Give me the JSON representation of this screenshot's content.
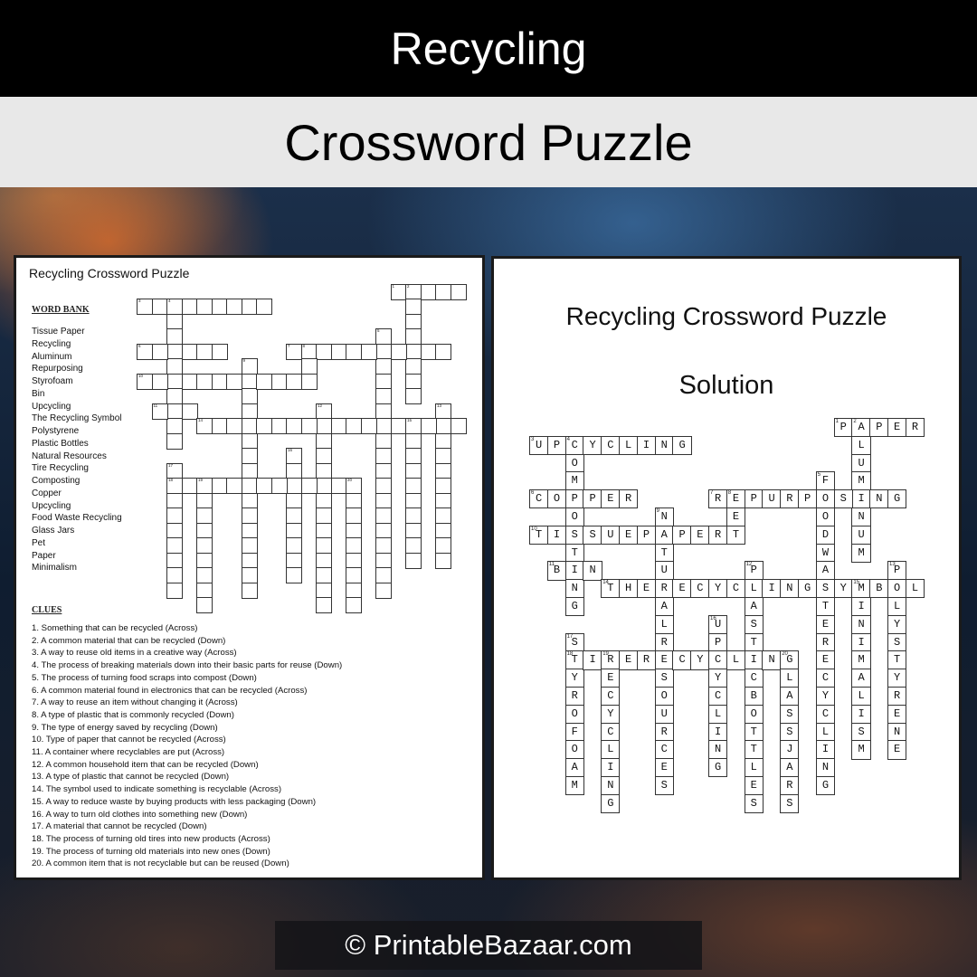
{
  "header": {
    "title": "Recycling",
    "subtitle": "Crossword Puzzle"
  },
  "puzzle": {
    "title": "Recycling Crossword Puzzle",
    "word_bank_heading": "WORD BANK",
    "word_bank": [
      "Tissue Paper",
      "Recycling",
      "Aluminum",
      "Repurposing",
      "Styrofoam",
      "Bin",
      "Upcycling",
      "The Recycling Symbol",
      "Polystyrene",
      "Plastic Bottles",
      "Natural Resources",
      "Tire Recycling",
      "Composting",
      "Copper",
      "Upcycling",
      "Food Waste Recycling",
      "Glass Jars",
      "Pet",
      "Paper",
      "Minimalism"
    ],
    "clues_heading": "CLUES",
    "clues": [
      "1. Something that can be recycled (Across)",
      "2. A common  material that can be recycled (Down)",
      "3. A way to reuse old items in a creative way (Across)",
      "4. The process of breaking materials down into their basic parts for reuse (Down)",
      "5. The process of turning  food scraps into compost (Down)",
      "6. A common  material found in electronics that can be recycled (Across)",
      "7. A way to reuse an item without  changing it (Across)",
      "8. A type of plastic that is commonly  recycled (Down)",
      "9. The type of energy saved by recycling (Down)",
      "10. Type of paper that cannot be recycled (Across)",
      "11. A container where recyclables are put  (Across)",
      "12. A common  household item that can be recycled (Down)",
      "13. A type of plastic that cannot  be recycled (Down)",
      "14. The symbol used to indicate something  is recyclable (Across)",
      "15. A way to reduce waste by buying products  with  less packaging (Down)",
      "16. A way to turn old clothes into something new (Down)",
      "17. A material that cannot be recycled (Down)",
      "18. The process of turning old tires into new products  (Across)",
      "19. The process of turning old materials into new ones (Down)",
      "20. A common  item that is not recyclable but can be reused (Down)"
    ]
  },
  "solution": {
    "title": "Recycling Crossword Puzzle",
    "subtitle": "Solution"
  },
  "crossword": {
    "words": [
      {
        "n": 1,
        "dir": "across",
        "row": 0,
        "col": 17,
        "answer": "PAPER"
      },
      {
        "n": 2,
        "dir": "down",
        "row": 0,
        "col": 18,
        "answer": "ALUMINUM"
      },
      {
        "n": 3,
        "dir": "across",
        "row": 1,
        "col": 0,
        "answer": "UPCYCLING"
      },
      {
        "n": 4,
        "dir": "down",
        "row": 1,
        "col": 2,
        "answer": "COMPOSTING"
      },
      {
        "n": 5,
        "dir": "down",
        "row": 3,
        "col": 16,
        "answer": "FOODWASTERECYCLING"
      },
      {
        "n": 6,
        "dir": "across",
        "row": 4,
        "col": 0,
        "answer": "COPPER"
      },
      {
        "n": 7,
        "dir": "across",
        "row": 4,
        "col": 10,
        "answer": "REPURPOSING"
      },
      {
        "n": 8,
        "dir": "down",
        "row": 4,
        "col": 11,
        "answer": "PET"
      },
      {
        "n": 9,
        "dir": "down",
        "row": 5,
        "col": 7,
        "answer": "NATURALRESOURCES"
      },
      {
        "n": 10,
        "dir": "across",
        "row": 6,
        "col": 0,
        "answer": "TISSUEPAPER"
      },
      {
        "n": 11,
        "dir": "across",
        "row": 8,
        "col": 1,
        "answer": "BIN"
      },
      {
        "n": 12,
        "dir": "down",
        "row": 8,
        "col": 12,
        "answer": "PLASTICBOTTLES"
      },
      {
        "n": 13,
        "dir": "down",
        "row": 8,
        "col": 20,
        "answer": "POLYSTYRENE"
      },
      {
        "n": 14,
        "dir": "across",
        "row": 9,
        "col": 4,
        "answer": "THERECYCLINGSYMBOL"
      },
      {
        "n": 15,
        "dir": "down",
        "row": 9,
        "col": 18,
        "answer": "MINIMALISM"
      },
      {
        "n": 16,
        "dir": "down",
        "row": 11,
        "col": 10,
        "answer": "UPCYCLING"
      },
      {
        "n": 17,
        "dir": "down",
        "row": 12,
        "col": 2,
        "answer": "STYROFOAM"
      },
      {
        "n": 18,
        "dir": "across",
        "row": 13,
        "col": 2,
        "answer": "TIRERECYCLING"
      },
      {
        "n": 19,
        "dir": "down",
        "row": 13,
        "col": 4,
        "answer": "RECYCLING"
      },
      {
        "n": 20,
        "dir": "down",
        "row": 13,
        "col": 14,
        "answer": "GLASSJARS"
      }
    ]
  },
  "footer": {
    "text": "© PrintableBazaar.com"
  }
}
